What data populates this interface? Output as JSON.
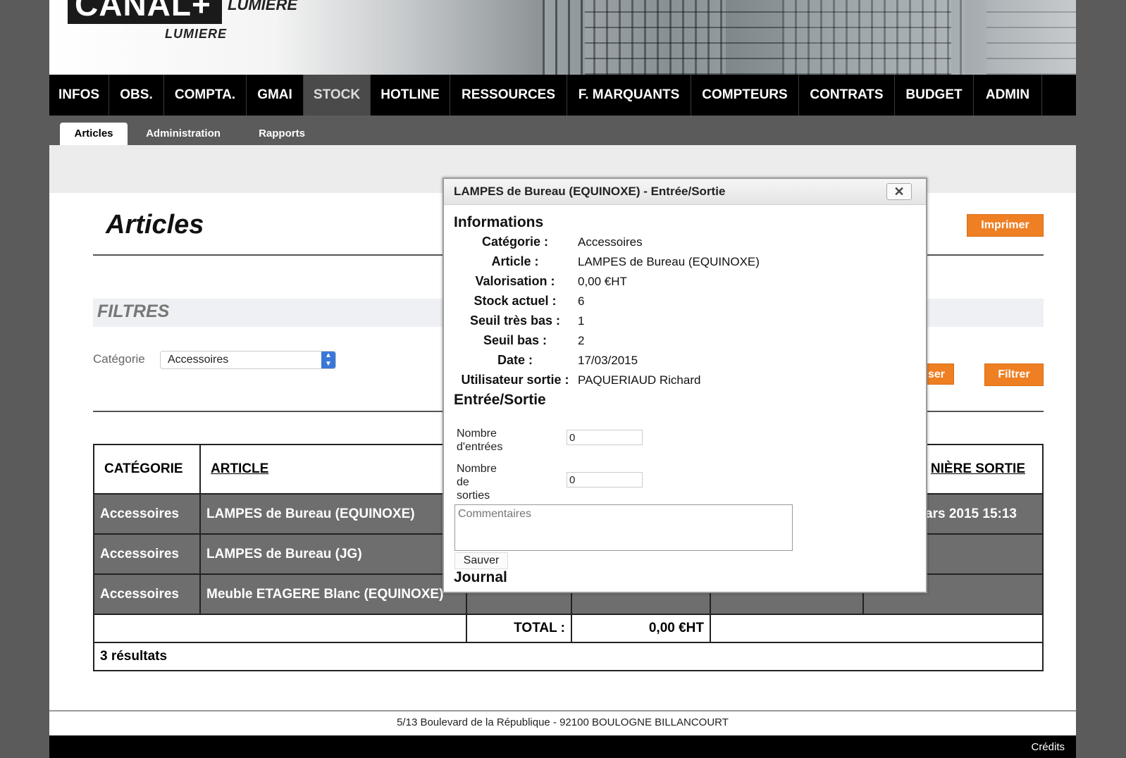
{
  "header": {
    "logo_text": "CANAL+",
    "logo_lumiere_top": "LUMIERE",
    "logo_lumiere_sub": "LUMIERE"
  },
  "nav": {
    "items": [
      "INFOS",
      "OBS.",
      "COMPTA.",
      "GMAI",
      "STOCK",
      "HOTLINE",
      "RESSOURCES",
      "F. MARQUANTS",
      "COMPTEURS",
      "CONTRATS",
      "BUDGET",
      "ADMIN"
    ],
    "active": "STOCK"
  },
  "subnav": {
    "items": [
      "Articles",
      "Administration",
      "Rapports"
    ],
    "active": "Articles"
  },
  "page": {
    "title": "Articles",
    "print_button": "Imprimer",
    "filters_title": "FILTRES",
    "category_label": "Catégorie",
    "category_value": "Accessoires",
    "reset_button_partial": "aliser",
    "filter_button": "Filtrer"
  },
  "table": {
    "headers": {
      "category": "CATÉGORIE",
      "article": "ARTICLE",
      "last_exit_partial": "NIÈRE SORTIE"
    },
    "rows": [
      {
        "category": "Accessoires",
        "article": "LAMPES de Bureau (EQUINOXE)",
        "last_exit_partial": "ars 2015 15:13"
      },
      {
        "category": "Accessoires",
        "article": "LAMPES de Bureau (JG)",
        "last_exit_partial": ""
      },
      {
        "category": "Accessoires",
        "article": "Meuble ETAGERE Blanc (EQUINOXE)",
        "last_exit_partial": ""
      }
    ],
    "total_label": "TOTAL :",
    "total_value": "0,00 €HT",
    "results_count": "3 résultats"
  },
  "modal": {
    "title": "LAMPES de Bureau (EQUINOXE) - Entrée/Sortie",
    "close_label": "✕",
    "info_section": "Informations",
    "info": [
      {
        "label": "Catégorie :",
        "value": "Accessoires"
      },
      {
        "label": "Article :",
        "value": "LAMPES de Bureau (EQUINOXE)"
      },
      {
        "label": "Valorisation :",
        "value": "0,00 €HT"
      },
      {
        "label": "Stock actuel :",
        "value": "6"
      },
      {
        "label": "Seuil très bas :",
        "value": "1"
      },
      {
        "label": "Seuil bas :",
        "value": "2"
      },
      {
        "label": "Date :",
        "value": "17/03/2015"
      },
      {
        "label": "Utilisateur sortie :",
        "value": "PAQUERIAUD Richard"
      }
    ],
    "io_section": "Entrée/Sortie",
    "entries_label_1": "Nombre",
    "entries_label_2": "d'entrées",
    "entries_value": "0",
    "exits_label_1": "Nombre",
    "exits_label_2": "de",
    "exits_label_3": "sorties",
    "exits_value": "0",
    "comment_placeholder": "Commentaires",
    "save_button": "Sauver",
    "journal_section": "Journal"
  },
  "footer": {
    "address": "5/13 Boulevard de la République - 92100 BOULOGNE BILLANCOURT",
    "credits": "Crédits"
  },
  "colors": {
    "accent_orange": "#ef7f23",
    "nav_black": "#000000",
    "row_gray": "#6e6e6e"
  }
}
